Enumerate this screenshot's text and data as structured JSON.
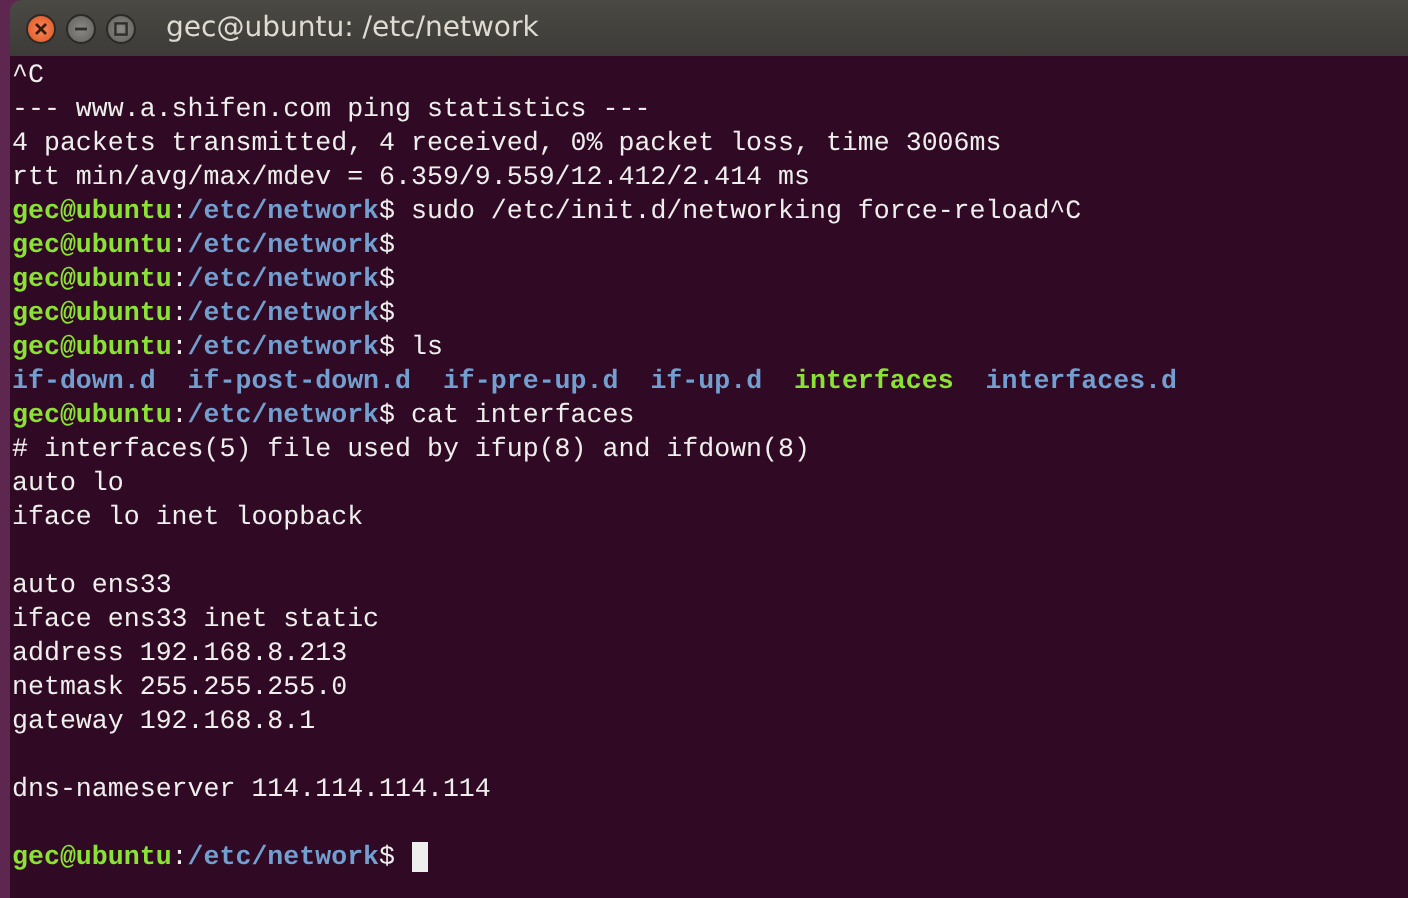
{
  "window": {
    "title": "gec@ubuntu: /etc/network"
  },
  "terminal": {
    "lines": [
      {
        "kind": "text",
        "text": "^C"
      },
      {
        "kind": "text",
        "text": "--- www.a.shifen.com ping statistics ---"
      },
      {
        "kind": "text",
        "text": "4 packets transmitted, 4 received, 0% packet loss, time 3006ms"
      },
      {
        "kind": "text",
        "text": "rtt min/avg/max/mdev = 6.359/9.559/12.412/2.414 ms"
      },
      {
        "kind": "prompt",
        "user": "gec@ubuntu",
        "separator": ":",
        "path": "/etc/network",
        "symbol": "$",
        "command": "sudo /etc/init.d/networking force-reload^C"
      },
      {
        "kind": "prompt",
        "user": "gec@ubuntu",
        "separator": ":",
        "path": "/etc/network",
        "symbol": "$"
      },
      {
        "kind": "prompt",
        "user": "gec@ubuntu",
        "separator": ":",
        "path": "/etc/network",
        "symbol": "$"
      },
      {
        "kind": "prompt",
        "user": "gec@ubuntu",
        "separator": ":",
        "path": "/etc/network",
        "symbol": "$"
      },
      {
        "kind": "prompt",
        "user": "gec@ubuntu",
        "separator": ":",
        "path": "/etc/network",
        "symbol": "$",
        "command": "ls"
      },
      {
        "kind": "listing",
        "entries": [
          {
            "kind": "directory",
            "name": "if-down.d"
          },
          {
            "kind": "directory",
            "name": "if-post-down.d"
          },
          {
            "kind": "directory",
            "name": "if-pre-up.d"
          },
          {
            "kind": "directory",
            "name": "if-up.d"
          },
          {
            "kind": "executable",
            "name": "interfaces"
          },
          {
            "kind": "directory",
            "name": "interfaces.d"
          }
        ]
      },
      {
        "kind": "prompt",
        "user": "gec@ubuntu",
        "separator": ":",
        "path": "/etc/network",
        "symbol": "$",
        "command": "cat interfaces"
      },
      {
        "kind": "text",
        "text": "# interfaces(5) file used by ifup(8) and ifdown(8)"
      },
      {
        "kind": "text",
        "text": "auto lo"
      },
      {
        "kind": "text",
        "text": "iface lo inet loopback"
      },
      {
        "kind": "blank"
      },
      {
        "kind": "text",
        "text": "auto ens33"
      },
      {
        "kind": "text",
        "text": "iface ens33 inet static"
      },
      {
        "kind": "text",
        "text": "address 192.168.8.213"
      },
      {
        "kind": "text",
        "text": "netmask 255.255.255.0"
      },
      {
        "kind": "text",
        "text": "gateway 192.168.8.1"
      },
      {
        "kind": "blank"
      },
      {
        "kind": "text",
        "text": "dns-nameserver 114.114.114.114"
      },
      {
        "kind": "blank"
      },
      {
        "kind": "prompt",
        "user": "gec@ubuntu",
        "separator": ":",
        "path": "/etc/network",
        "symbol": "$",
        "cursor": true
      }
    ]
  }
}
